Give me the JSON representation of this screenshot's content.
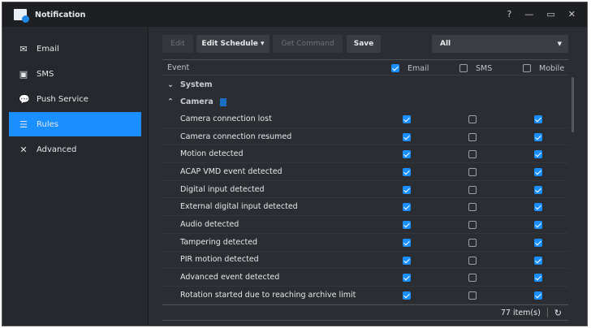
{
  "window": {
    "title": "Notification",
    "controls": [
      "?",
      "—",
      "▭",
      "✕"
    ]
  },
  "sidebar": {
    "items": [
      {
        "label": "Email",
        "icon": "✉"
      },
      {
        "label": "SMS",
        "icon": "▣"
      },
      {
        "label": "Push Service",
        "icon": "💬"
      },
      {
        "label": "Rules",
        "icon": "☰"
      },
      {
        "label": "Advanced",
        "icon": "✕"
      }
    ]
  },
  "toolbar": {
    "edit": "Edit",
    "edit_schedule": "Edit Schedule ▾",
    "get_command": "Get Command",
    "save": "Save",
    "filter": "All"
  },
  "table": {
    "headers": {
      "event": "Event",
      "email": "Email",
      "sms": "SMS",
      "mobile": "Mobile"
    },
    "groups": {
      "system": "System",
      "camera": "Camera"
    },
    "rows": [
      {
        "event": "Camera connection lost",
        "email": true,
        "sms": false,
        "mobile": true
      },
      {
        "event": "Camera connection resumed",
        "email": true,
        "sms": false,
        "mobile": true
      },
      {
        "event": "Motion detected",
        "email": true,
        "sms": false,
        "mobile": true
      },
      {
        "event": "ACAP VMD event detected",
        "email": true,
        "sms": false,
        "mobile": true
      },
      {
        "event": "Digital input detected",
        "email": true,
        "sms": false,
        "mobile": true
      },
      {
        "event": "External digital input detected",
        "email": true,
        "sms": false,
        "mobile": true
      },
      {
        "event": "Audio detected",
        "email": true,
        "sms": false,
        "mobile": true
      },
      {
        "event": "Tampering detected",
        "email": true,
        "sms": false,
        "mobile": true
      },
      {
        "event": "PIR motion detected",
        "email": true,
        "sms": false,
        "mobile": true
      },
      {
        "event": "Advanced event detected",
        "email": true,
        "sms": false,
        "mobile": true
      },
      {
        "event": "Rotation started due to reaching archive limit",
        "email": true,
        "sms": false,
        "mobile": true
      }
    ]
  },
  "footer": {
    "count": "77 item(s)",
    "refresh": "↻"
  }
}
